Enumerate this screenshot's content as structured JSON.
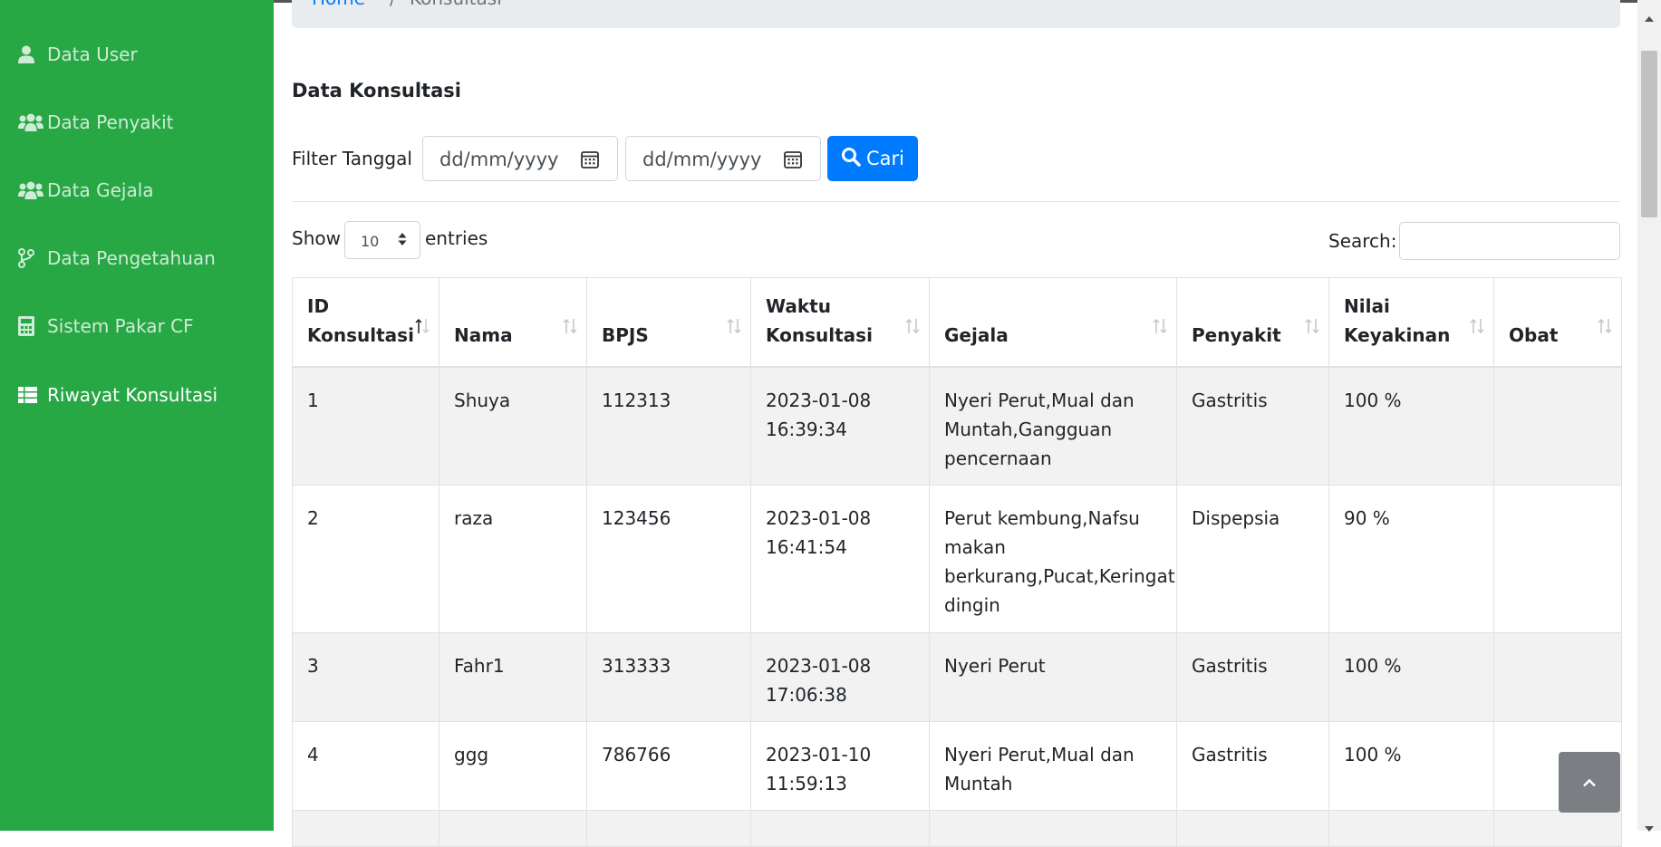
{
  "sidebar": {
    "items": [
      {
        "label": "Data User",
        "icon": "user-icon"
      },
      {
        "label": "Data Penyakit",
        "icon": "users-icon"
      },
      {
        "label": "Data Gejala",
        "icon": "users-icon"
      },
      {
        "label": "Data Pengetahuan",
        "icon": "code-branch-icon"
      },
      {
        "label": "Sistem Pakar CF",
        "icon": "calculator-icon"
      },
      {
        "label": "Riwayat Konsultasi",
        "icon": "table-icon",
        "active": true
      }
    ],
    "color": "#28a745"
  },
  "breadcrumb": {
    "home": "Home",
    "separator": "/",
    "current": "Konsultasi"
  },
  "page_title": "Data Konsultasi",
  "filter": {
    "label": "Filter Tanggal",
    "start_placeholder": "dd/mm/yyyy",
    "end_placeholder": "dd/mm/yyyy",
    "search_button": "Cari"
  },
  "datatable": {
    "show_label": "Show",
    "length_value": "10",
    "entries_label": "entries",
    "search_label": "Search:",
    "search_value": ""
  },
  "table": {
    "headers": [
      {
        "line1": "ID",
        "line2": "Konsultasi"
      },
      {
        "line1": "",
        "line2": "Nama"
      },
      {
        "line1": "",
        "line2": "BPJS"
      },
      {
        "line1": "Waktu",
        "line2": "Konsultasi"
      },
      {
        "line1": "",
        "line2": "Gejala"
      },
      {
        "line1": "",
        "line2": "Penyakit"
      },
      {
        "line1": "Nilai",
        "line2": "Keyakinan"
      },
      {
        "line1": "",
        "line2": "Obat"
      }
    ],
    "rows": [
      {
        "id": "1",
        "nama": "Shuya",
        "bpjs": "112313",
        "waktu_date": "2023-01-08",
        "waktu_time": "16:39:34",
        "gejala": "Nyeri Perut,Mual dan Muntah,Gangguan pencernaan",
        "penyakit": "Gastritis",
        "nilai": "100 %",
        "obat": ""
      },
      {
        "id": "2",
        "nama": "raza",
        "bpjs": "123456",
        "waktu_date": "2023-01-08",
        "waktu_time": "16:41:54",
        "gejala": "Perut kembung,Nafsu makan berkurang,Pucat,Keringat dingin",
        "penyakit": "Dispepsia",
        "nilai": "90 %",
        "obat": ""
      },
      {
        "id": "3",
        "nama": "Fahr1",
        "bpjs": "313333",
        "waktu_date": "2023-01-08",
        "waktu_time": "17:06:38",
        "gejala": "Nyeri Perut",
        "penyakit": "Gastritis",
        "nilai": "100 %",
        "obat": ""
      },
      {
        "id": "4",
        "nama": "ggg",
        "bpjs": "786766",
        "waktu_date": "2023-01-10",
        "waktu_time": "11:59:13",
        "gejala": "Nyeri Perut,Mual dan Muntah",
        "penyakit": "Gastritis",
        "nilai": "100 %",
        "obat": ""
      },
      {
        "id": "",
        "nama": "",
        "bpjs": "",
        "waktu_date": "",
        "waktu_time": "",
        "gejala": "",
        "penyakit": "",
        "nilai": "",
        "obat": ""
      }
    ]
  },
  "back_to_top": {
    "icon": "chevron-up-icon"
  }
}
